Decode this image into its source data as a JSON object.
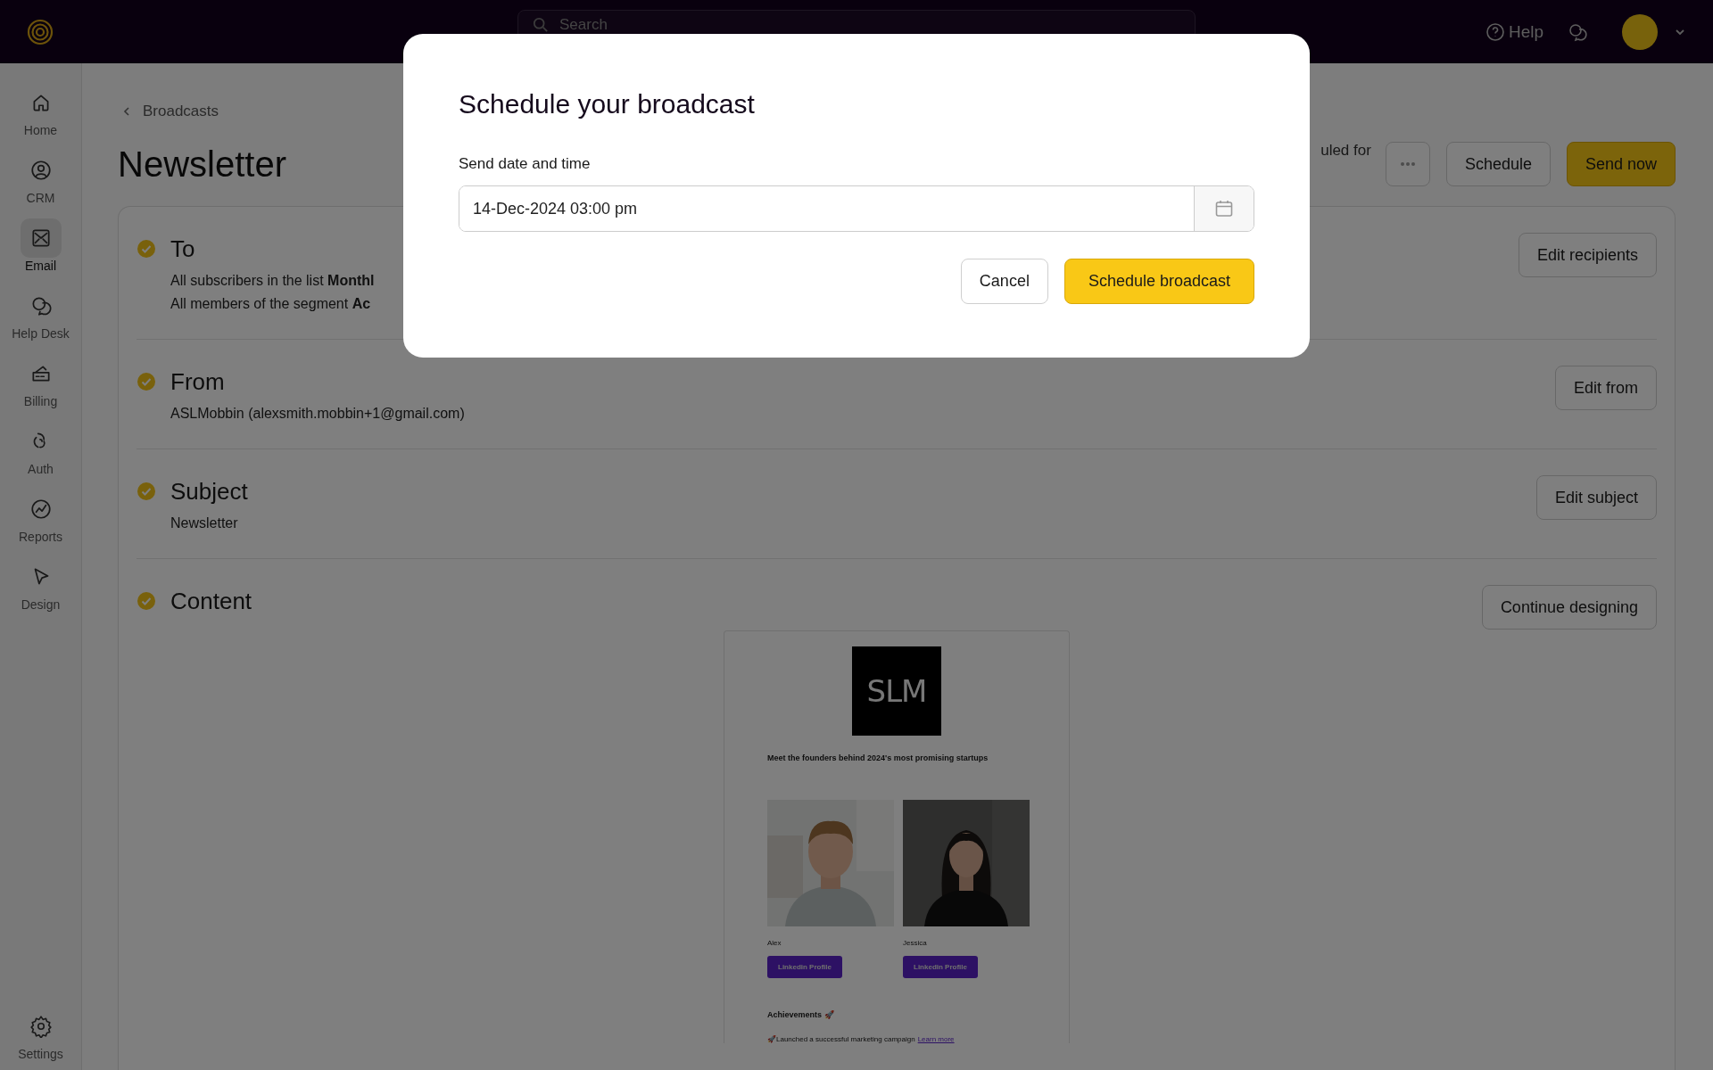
{
  "topbar": {
    "search": {
      "placeholder": "Search"
    },
    "help": "Help"
  },
  "sidebar": {
    "items": [
      {
        "label": "Home",
        "kind": "home",
        "selected": false
      },
      {
        "label": "CRM",
        "kind": "crm",
        "selected": false
      },
      {
        "label": "Email",
        "kind": "email",
        "selected": true
      },
      {
        "label": "Help Desk",
        "kind": "helpdesk",
        "selected": false
      },
      {
        "label": "Billing",
        "kind": "billing",
        "selected": false
      },
      {
        "label": "Auth",
        "kind": "auth",
        "selected": false
      },
      {
        "label": "Reports",
        "kind": "reports",
        "selected": false
      },
      {
        "label": "Design",
        "kind": "design",
        "selected": false
      }
    ],
    "footer": {
      "label": "Settings",
      "kind": "settings",
      "selected": false
    }
  },
  "breadcrumb": "Broadcasts",
  "title": "Newsletter",
  "header": {
    "status_text": "uled for",
    "buttons": [
      {
        "label": "Schedule",
        "kind": "outline"
      },
      {
        "label": "Send now",
        "kind": "primary"
      }
    ]
  },
  "sections": [
    {
      "title": "To",
      "kind": "text",
      "checked": true,
      "lines": [
        "All subscribers in the list **Monthl**",
        "All members of the segment **Ac**"
      ],
      "action": "Edit recipients"
    },
    {
      "title": "From",
      "kind": "text",
      "checked": true,
      "lines": [
        "ASLMobbin (alexsmith.mobbin+1@gmail.com)"
      ],
      "action": "Edit from"
    },
    {
      "title": "Subject",
      "kind": "text",
      "checked": true,
      "lines": [
        "Newsletter"
      ],
      "action": "Edit subject"
    },
    {
      "title": "Content",
      "kind": "preview",
      "checked": true,
      "action": "Continue designing"
    }
  ],
  "email_preview": {
    "logo": "SLM",
    "heading": "Meet the founders behind 2024's most promising startups",
    "founders": [
      {
        "name": "Alex",
        "button": "Linkedin Profile",
        "kind": "light"
      },
      {
        "name": "Jessica",
        "button": "Linkedin Profile",
        "kind": "dark"
      }
    ],
    "achievements_title": "Achievements 🚀",
    "achievement": {
      "text": "🚀Launched a successful marketing campaign",
      "link": "Learn more"
    }
  },
  "modal": {
    "title": "Schedule your broadcast",
    "field_label": "Send date and time",
    "value": "14-Dec-2024 03:00 pm",
    "buttons": [
      {
        "label": "Cancel",
        "kind": "secondary"
      },
      {
        "label": "Schedule broadcast",
        "kind": "primary"
      }
    ]
  }
}
